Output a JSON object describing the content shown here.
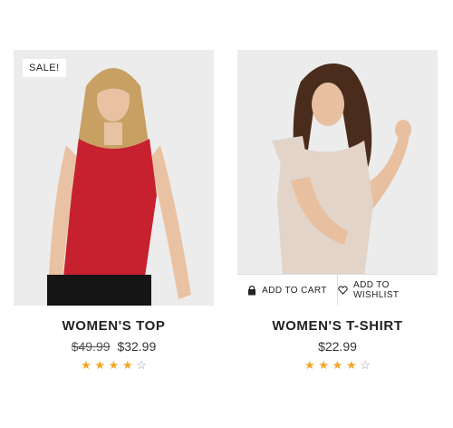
{
  "products": [
    {
      "badge": "SALE!",
      "title": "WOMEN'S TOP",
      "old_price": "$49.99",
      "price": "$32.99",
      "rating": 4,
      "rating_max": 5,
      "colors": {
        "garment": "#c7202e",
        "skin": "#e9c2a4",
        "hair": "#c9a064"
      }
    },
    {
      "title": "WOMEN'S T-SHIRT",
      "price": "$22.99",
      "rating": 4,
      "rating_max": 5,
      "actions": {
        "cart_label": "ADD TO CART",
        "wishlist_label": "ADD TO WISHLIST"
      },
      "colors": {
        "garment": "#e2d4c9",
        "skin": "#e8bf9f",
        "hair": "#4a2c1d"
      }
    }
  ],
  "theme": {
    "star": "#f5a623",
    "star_empty": "#9a9a9a",
    "image_bg": "#ececec"
  }
}
